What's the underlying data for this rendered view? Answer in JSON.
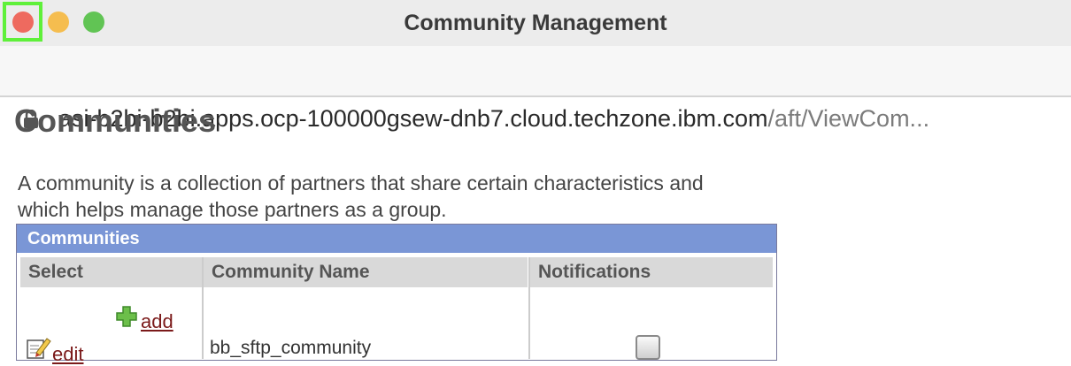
{
  "window": {
    "title": "Community Management"
  },
  "address_bar": {
    "host": "asi-b2bi-b2bi.apps.ocp-100000gsew-dnb7.cloud.techzone.ibm.com",
    "path": "/aft/ViewCom..."
  },
  "page": {
    "title": "Communities",
    "description": "A community is a collection of partners that share certain characteristics and which helps manage those partners as a group."
  },
  "table": {
    "caption": "Communities",
    "columns": [
      "Select",
      "Community Name",
      "Notifications"
    ],
    "add_label": " add",
    "rows": [
      {
        "edit_label": " edit",
        "community_name": "bb_sftp_community",
        "notifications_checked": false
      }
    ]
  },
  "colors": {
    "caption_bg": "#7a96d6",
    "link": "#7b1a1a",
    "highlight": "#5ff03a"
  }
}
